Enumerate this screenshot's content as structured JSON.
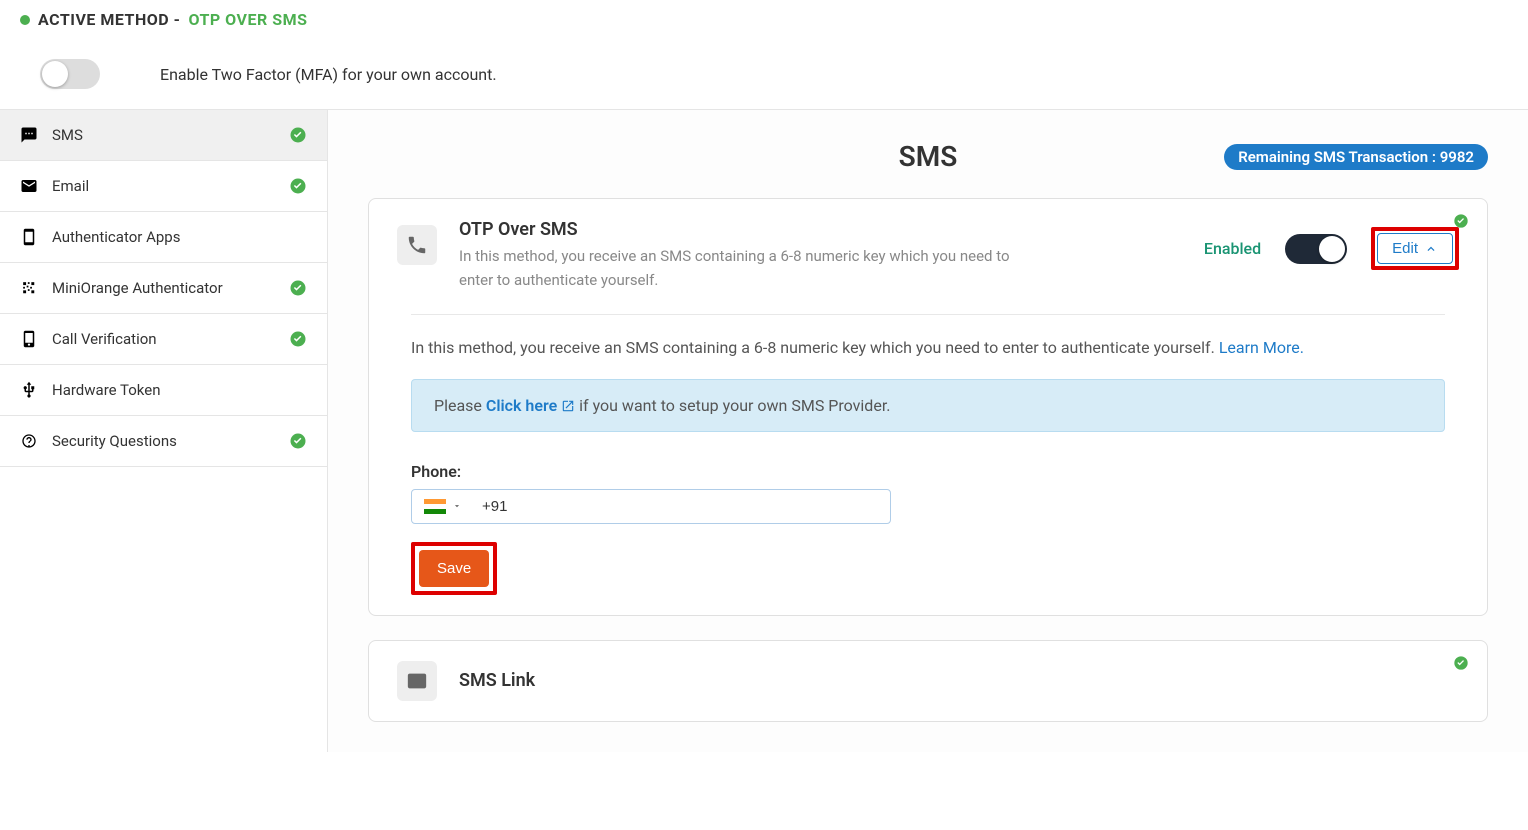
{
  "top": {
    "active_method_label": "ACTIVE METHOD - ",
    "active_method_value": "OTP OVER SMS"
  },
  "toggle": {
    "label": "Enable Two Factor (MFA) for your own account."
  },
  "sidebar": {
    "items": [
      {
        "label": "SMS",
        "icon": "message",
        "checked": true,
        "active": true
      },
      {
        "label": "Email",
        "icon": "envelope",
        "checked": true,
        "active": false
      },
      {
        "label": "Authenticator Apps",
        "icon": "phone-app",
        "checked": false,
        "active": false
      },
      {
        "label": "MiniOrange Authenticator",
        "icon": "qr",
        "checked": true,
        "active": false
      },
      {
        "label": "Call Verification",
        "icon": "phone-call",
        "checked": true,
        "active": false
      },
      {
        "label": "Hardware Token",
        "icon": "usb",
        "checked": false,
        "active": false
      },
      {
        "label": "Security Questions",
        "icon": "question",
        "checked": true,
        "active": false
      }
    ]
  },
  "content": {
    "title": "SMS",
    "remaining_badge": "Remaining SMS Transaction : 9982"
  },
  "card1": {
    "title": "OTP Over SMS",
    "description": "In this method, you receive an SMS containing a 6-8 numeric key which you need to enter to authenticate yourself.",
    "enabled_label": "Enabled",
    "edit_label": "Edit",
    "body_text": "In this method, you receive an SMS containing a 6-8 numeric key which you need to enter to authenticate yourself. ",
    "learn_more": "Learn More.",
    "info_prefix": "Please ",
    "info_link": "Click here",
    "info_suffix": " if you want to setup your own SMS Provider.",
    "phone_label": "Phone:",
    "phone_value": "+91",
    "save_label": "Save"
  },
  "card2": {
    "title": "SMS Link"
  }
}
